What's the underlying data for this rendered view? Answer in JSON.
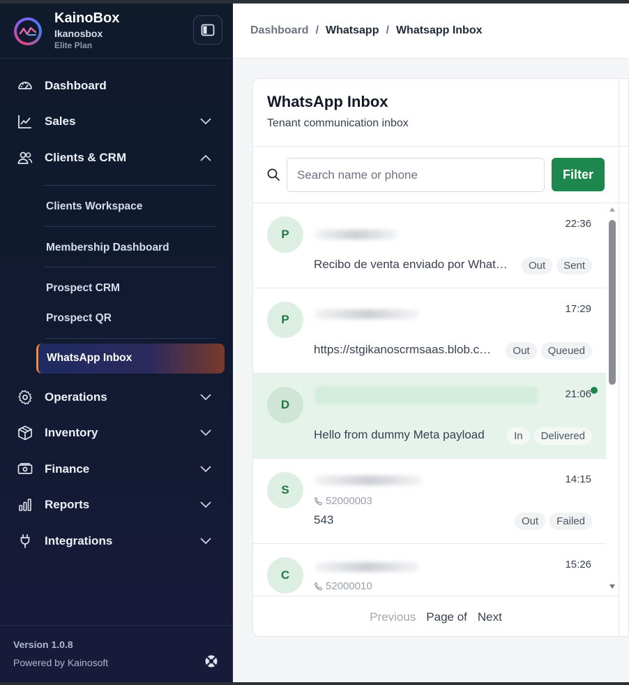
{
  "brand": {
    "name": "KainoBox",
    "tenant": "Ikanosbox",
    "plan": "Elite Plan"
  },
  "nav": {
    "dashboard": "Dashboard",
    "sales": "Sales",
    "clients": "Clients & CRM",
    "sub": {
      "workspace": "Clients Workspace",
      "membership": "Membership Dashboard",
      "prospect_crm": "Prospect CRM",
      "prospect_qr": "Prospect QR",
      "whatsapp": "WhatsApp Inbox"
    },
    "operations": "Operations",
    "inventory": "Inventory",
    "finance": "Finance",
    "reports": "Reports",
    "integrations": "Integrations"
  },
  "footer": {
    "version": "Version 1.0.8",
    "powered": "Powered by Kainosoft"
  },
  "breadcrumb": [
    "Dashboard",
    "Whatsapp",
    "Whatsapp Inbox"
  ],
  "inbox": {
    "title": "WhatsApp Inbox",
    "subtitle": "Tenant communication inbox",
    "search_placeholder": "Search name or phone",
    "filter_label": "Filter"
  },
  "conversations": [
    {
      "initial": "P",
      "time": "22:36",
      "phone": "",
      "preview": "Recibo de venta enviado por WhatsApp",
      "direction": "Out",
      "status": "Sent",
      "highlighted": false,
      "unread": false
    },
    {
      "initial": "P",
      "time": "17:29",
      "phone": "",
      "preview": "https://stgikanoscrmsaas.blob.core",
      "direction": "Out",
      "status": "Queued",
      "highlighted": false,
      "unread": false
    },
    {
      "initial": "D",
      "time": "21:06",
      "phone": "",
      "preview": "Hello from dummy Meta payload",
      "direction": "In",
      "status": "Delivered",
      "highlighted": true,
      "unread": true
    },
    {
      "initial": "S",
      "time": "14:15",
      "phone": "52000003",
      "preview": "543",
      "direction": "Out",
      "status": "Failed",
      "highlighted": false,
      "unread": false
    },
    {
      "initial": "C",
      "time": "15:26",
      "phone": "52000010",
      "preview": "",
      "direction": "",
      "status": "",
      "highlighted": false,
      "unread": false
    }
  ],
  "pager": {
    "previous": "Previous",
    "page": "Page of",
    "next": "Next"
  },
  "colors": {
    "accent": "#1e874e",
    "active_border": "#f08a3c"
  }
}
